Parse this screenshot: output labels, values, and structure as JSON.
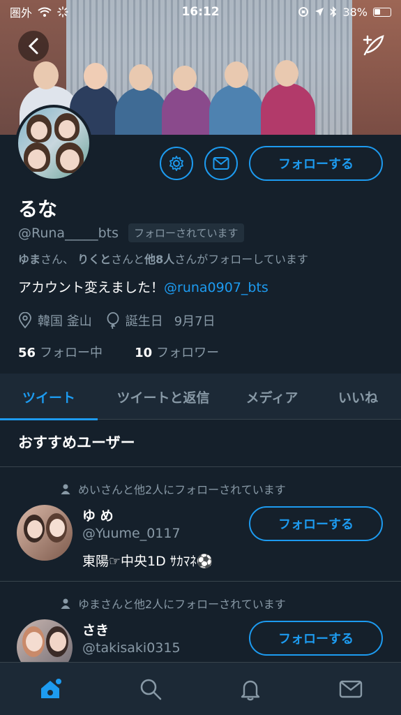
{
  "status_bar": {
    "carrier": "圏外",
    "time": "16:12",
    "battery": "38%"
  },
  "profile": {
    "name": "るな",
    "handle": "@Runa_____bts",
    "follows_you_badge": "フォローされています",
    "known_followers": {
      "user1": "ゆま",
      "sep1": "さん、",
      "user2": "りくと",
      "sep2": "さんと",
      "others": "他8人",
      "suffix": "さんがフォローしています"
    },
    "bio_text": "アカウント変えました！",
    "bio_mention": "@runa0907_bts",
    "location": "韓国 釜山",
    "birthday_label": "誕生日",
    "birthday": "9月7日",
    "following_count": "56",
    "following_label": "フォロー中",
    "followers_count": "10",
    "followers_label": "フォロワー",
    "follow_button": "フォローする"
  },
  "tabs": [
    "ツイート",
    "ツイートと返信",
    "メディア",
    "いいね"
  ],
  "suggestions": {
    "title": "おすすめユーザー",
    "users": [
      {
        "note": "めいさんと他2人にフォローされています",
        "name": "ゆ め",
        "handle": "@Yuume_0117",
        "bio": "東陽☞中央1D ｻｶﾏﾈ⚽",
        "follow_label": "フォローする"
      },
      {
        "note": "ゆまさんと他2人にフォローされています",
        "name": "さき",
        "handle": "@takisaki0315",
        "bio": "",
        "follow_label": "フォローする"
      }
    ]
  },
  "colors": {
    "background": "#15202b",
    "accent": "#1d9bf0",
    "secondary_text": "#8899a6"
  },
  "nav": [
    "home-icon",
    "search-icon",
    "bell-icon",
    "mail-icon"
  ]
}
